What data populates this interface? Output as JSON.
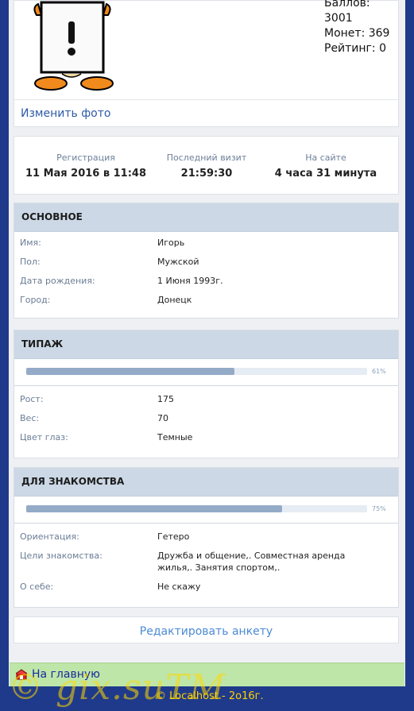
{
  "profile": {
    "stats": {
      "points": "Баллов: 3001",
      "coins": "Монет: 369",
      "rating": "Рейтинг: 0"
    },
    "change_photo": "Изменить фото"
  },
  "visit": {
    "registration_label": "Регистрация",
    "registration_value": "11 Мая 2016 в 11:48",
    "last_visit_label": "Последний визит",
    "last_visit_value": "21:59:30",
    "on_site_label": "На сайте",
    "on_site_value": "4 часа 31 минута"
  },
  "basic": {
    "title": "ОСНОВНОЕ",
    "rows": [
      {
        "label": "Имя:",
        "value": "Игорь"
      },
      {
        "label": "Пол:",
        "value": "Мужской"
      },
      {
        "label": "Дата рождения:",
        "value": "1 Июня 1993г."
      },
      {
        "label": "Город:",
        "value": "Донецк"
      }
    ]
  },
  "type": {
    "title": "ТИПАЖ",
    "progress": 0.61,
    "progress_label": "61%",
    "rows": [
      {
        "label": "Рост:",
        "value": "175"
      },
      {
        "label": "Вес:",
        "value": "70"
      },
      {
        "label": "Цвет глаз:",
        "value": "Темные"
      }
    ]
  },
  "dating": {
    "title": "ДЛЯ ЗНАКОМСТВА",
    "progress": 0.75,
    "progress_label": "75%",
    "rows": [
      {
        "label": "Ориентация:",
        "value": "Гетеро"
      },
      {
        "label": "Цели знакомства:",
        "value_line1": "Дружба и общение,. Совместная аренда",
        "value_line2": "жилья,. Занятия спортом,."
      },
      {
        "label": "О себе:",
        "value": "Не скажу"
      }
    ]
  },
  "edit_label": "Редактировать анкету",
  "home_label": "На главную",
  "footer": "© Localhost - 2o16г.",
  "watermark": "© gix.suTM"
}
